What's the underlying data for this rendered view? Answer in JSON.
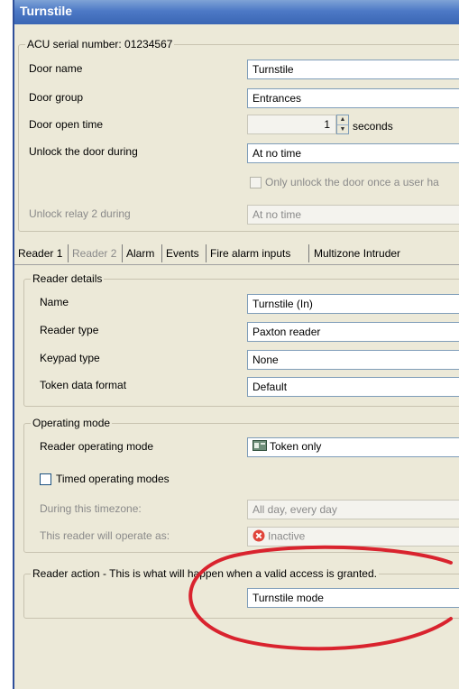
{
  "window": {
    "title": "Turnstile"
  },
  "acu": {
    "legend": "ACU serial number: 01234567",
    "door_name_label": "Door name",
    "door_name_value": "Turnstile",
    "door_group_label": "Door group",
    "door_group_value": "Entrances",
    "door_open_time_label": "Door open time",
    "door_open_time_value": "1",
    "door_open_time_unit": "seconds",
    "unlock_during_label": "Unlock the door during",
    "unlock_during_value": "At no time",
    "only_unlock_label": "Only unlock the door once a user ha",
    "unlock_relay_label": "Unlock relay 2 during",
    "unlock_relay_value": "At no time"
  },
  "tabs": [
    "Reader 1",
    "Reader 2",
    "Alarm",
    "Events",
    "Fire alarm inputs",
    "Multizone Intruder"
  ],
  "reader_details": {
    "legend": "Reader details",
    "name_label": "Name",
    "name_value": "Turnstile (In)",
    "reader_type_label": "Reader type",
    "reader_type_value": "Paxton reader",
    "keypad_type_label": "Keypad type",
    "keypad_type_value": "None",
    "token_format_label": "Token data format",
    "token_format_value": "Default"
  },
  "operating_mode": {
    "legend": "Operating mode",
    "reader_mode_label": "Reader operating mode",
    "reader_mode_value": "Token only",
    "timed_label": "Timed operating modes",
    "during_label": "During this timezone:",
    "during_value": "All day, every day",
    "operate_as_label": "This reader will operate as:",
    "operate_as_value": "Inactive"
  },
  "reader_action": {
    "legend": "Reader action - This is what will happen when a valid access is granted.",
    "value": "Turnstile mode"
  },
  "colors": {
    "highlight_ellipse": "#d9232e",
    "title_bar": "#4d79c6"
  },
  "icons": {
    "token": "card-reader-icon",
    "inactive": "red-x-icon"
  }
}
